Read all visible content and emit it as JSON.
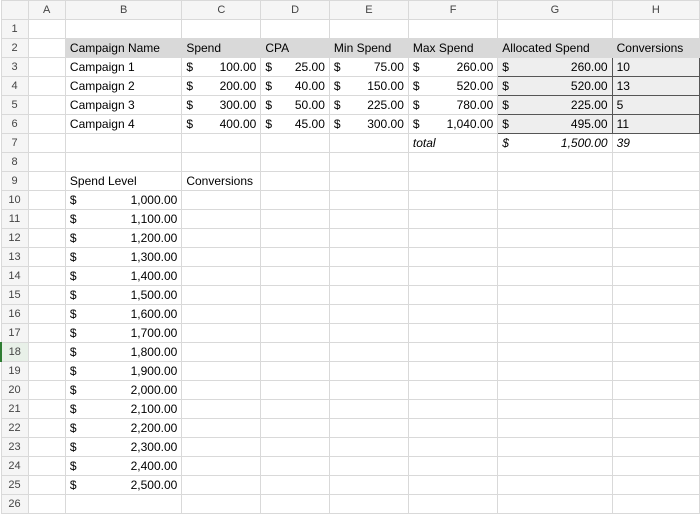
{
  "columns": [
    "",
    "A",
    "B",
    "C",
    "D",
    "E",
    "F",
    "G",
    "H"
  ],
  "headers": {
    "campaign_name": "Campaign Name",
    "spend": "Spend",
    "cpa": "CPA",
    "min_spend": "Min Spend",
    "max_spend": "Max Spend",
    "allocated_spend": "Allocated Spend",
    "conversions": "Conversions",
    "spend_level": "Spend Level",
    "conversions2": "Conversions",
    "total": "total"
  },
  "campaigns": [
    {
      "name": "Campaign 1",
      "spend": "100.00",
      "cpa": "25.00",
      "min": "75.00",
      "max": "260.00",
      "alloc": "260.00",
      "conv": "10"
    },
    {
      "name": "Campaign 2",
      "spend": "200.00",
      "cpa": "40.00",
      "min": "150.00",
      "max": "520.00",
      "alloc": "520.00",
      "conv": "13"
    },
    {
      "name": "Campaign 3",
      "spend": "300.00",
      "cpa": "50.00",
      "min": "225.00",
      "max": "780.00",
      "alloc": "225.00",
      "conv": "5"
    },
    {
      "name": "Campaign 4",
      "spend": "400.00",
      "cpa": "45.00",
      "min": "300.00",
      "max": "1,040.00",
      "alloc": "495.00",
      "conv": "11"
    }
  ],
  "totals": {
    "alloc": "1,500.00",
    "conv": "39"
  },
  "spend_levels": [
    "1,000.00",
    "1,100.00",
    "1,200.00",
    "1,300.00",
    "1,400.00",
    "1,500.00",
    "1,600.00",
    "1,700.00",
    "1,800.00",
    "1,900.00",
    "2,000.00",
    "2,100.00",
    "2,200.00",
    "2,300.00",
    "2,400.00",
    "2,500.00"
  ],
  "currency_symbol": "$",
  "active_row": 18
}
